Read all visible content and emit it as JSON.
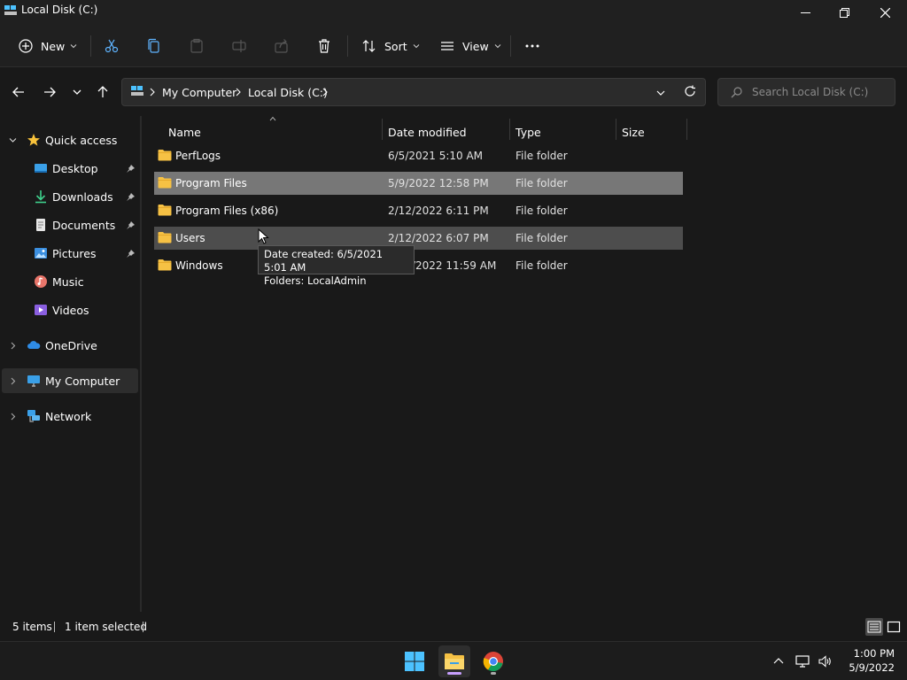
{
  "window": {
    "title": "Local Disk (C:)"
  },
  "toolbar": {
    "new_label": "New",
    "sort_label": "Sort",
    "view_label": "View"
  },
  "address": {
    "crumbs": [
      "My Computer",
      "Local Disk (C:)"
    ],
    "search_placeholder": "Search Local Disk (C:)"
  },
  "sidebar": {
    "quick_access": "Quick access",
    "items": [
      {
        "label": "Desktop",
        "icon": "desktop-icon",
        "pinned": true
      },
      {
        "label": "Downloads",
        "icon": "downloads-icon",
        "pinned": true
      },
      {
        "label": "Documents",
        "icon": "documents-icon",
        "pinned": true
      },
      {
        "label": "Pictures",
        "icon": "pictures-icon",
        "pinned": true
      },
      {
        "label": "Music",
        "icon": "music-icon",
        "pinned": false
      },
      {
        "label": "Videos",
        "icon": "videos-icon",
        "pinned": false
      }
    ],
    "onedrive": "OneDrive",
    "my_computer": "My Computer",
    "network": "Network"
  },
  "columns": {
    "name": "Name",
    "date": "Date modified",
    "type": "Type",
    "size": "Size"
  },
  "files": [
    {
      "name": "PerfLogs",
      "date": "6/5/2021 5:10 AM",
      "type": "File folder",
      "state": "normal"
    },
    {
      "name": "Program Files",
      "date": "5/9/2022 12:58 PM",
      "type": "File folder",
      "state": "selected"
    },
    {
      "name": "Program Files (x86)",
      "date": "2/12/2022 6:11 PM",
      "type": "File folder",
      "state": "normal"
    },
    {
      "name": "Users",
      "date": "2/12/2022 6:07 PM",
      "type": "File folder",
      "state": "hovered"
    },
    {
      "name": "Windows",
      "date": "2/12/2022 11:59 AM",
      "type": "File folder",
      "state": "normal"
    }
  ],
  "tooltip": {
    "line1": "Date created: 6/5/2021 5:01 AM",
    "line2": "Folders: LocalAdmin"
  },
  "status": {
    "items": "5 items",
    "selected": "1 item selected"
  },
  "clock": {
    "time": "1:00 PM",
    "date": "5/9/2022"
  },
  "colors": {
    "folder": "#f6c144",
    "selected_row": "#777777",
    "hover_row": "#4d4d4d",
    "accent": "#4cc2ff"
  }
}
